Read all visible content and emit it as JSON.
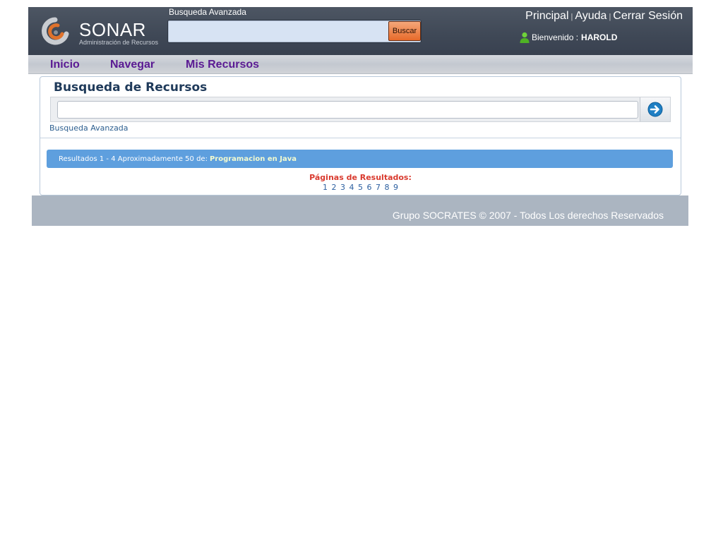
{
  "header": {
    "logo_name": "SONAR",
    "logo_subtitle": "Administración de Recursos",
    "advanced_search_label": "Busqueda Avanzada",
    "search_value": "",
    "search_button": "Buscar",
    "links": [
      "Principal",
      "Ayuda",
      "Cerrar Sesión"
    ],
    "welcome_prefix": "Bienvenido :",
    "user_name": "HAROLD"
  },
  "nav": {
    "items": [
      "Inicio",
      "Navegar",
      "Mis Recursos"
    ]
  },
  "search_panel": {
    "title": "Busqueda de Recursos",
    "query_value": "",
    "advanced_link": "Busqueda Avanzada"
  },
  "results": {
    "summary": "Resultados 1 - 4 Aproximadamente 50 de:",
    "query": "Programacion en Java",
    "pages_label": "Páginas de Resultados:",
    "pages": [
      "1",
      "2",
      "3",
      "4",
      "5",
      "6",
      "7",
      "8",
      "9"
    ]
  },
  "footer": {
    "text": "Grupo SOCRATES © 2007 - Todos Los derechos Reservados"
  },
  "colors": {
    "header_bg": "#424b59",
    "nav_link": "#5a1a93",
    "results_bar": "#5e9fde",
    "pages_label": "#d93a2e",
    "footer_bg": "#abb5c1"
  }
}
